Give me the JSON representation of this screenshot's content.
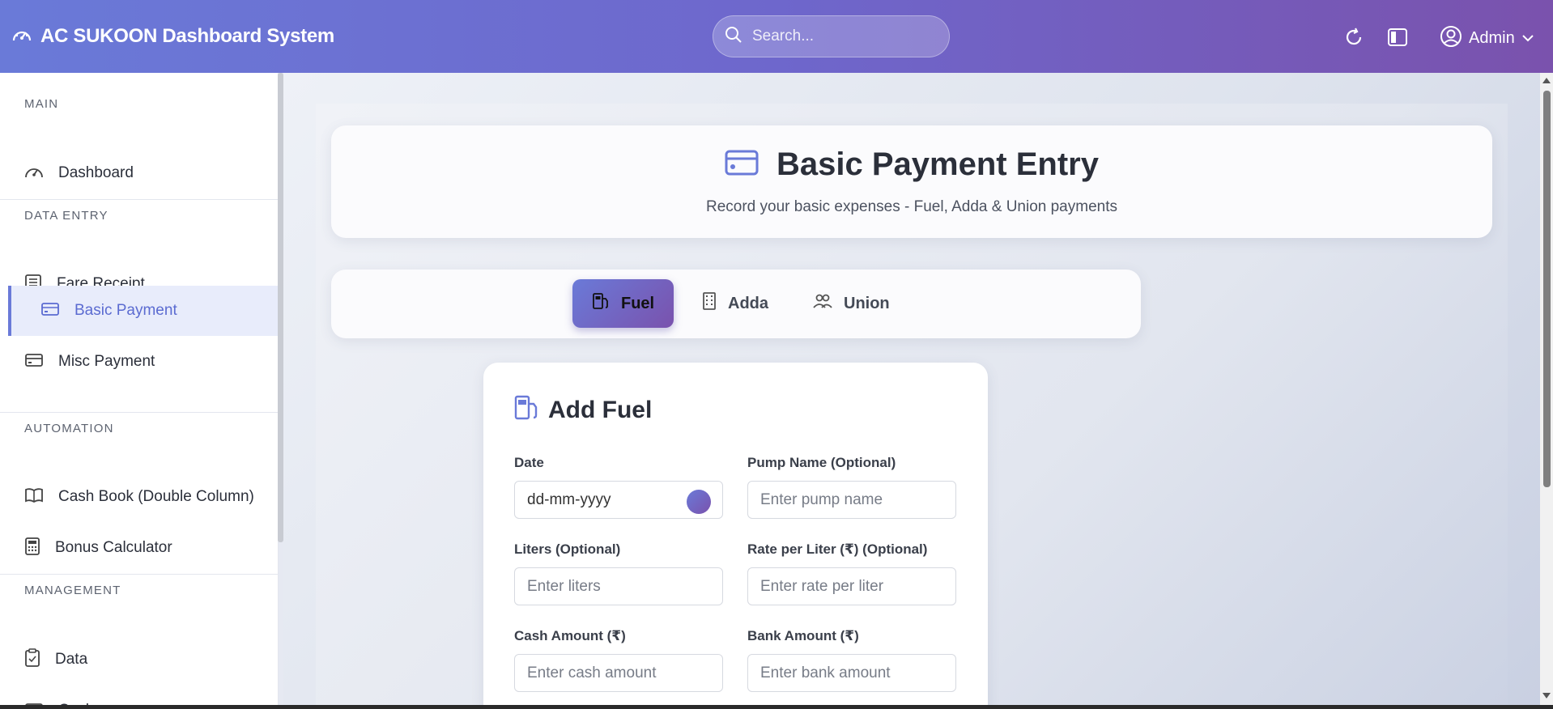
{
  "app": {
    "title": "AC SUKOON Dashboard System"
  },
  "search": {
    "placeholder": "Search..."
  },
  "header": {
    "admin_label": "Admin"
  },
  "sidebar": {
    "sections": [
      {
        "label": "MAIN",
        "items": [
          {
            "label": "Dashboard",
            "icon": "gauge-icon"
          }
        ]
      },
      {
        "label": "DATA ENTRY",
        "items": [
          {
            "label": "Fare Receipt",
            "icon": "receipt-icon"
          },
          {
            "label": "Basic Payment",
            "icon": "credit-card-icon",
            "active": true
          },
          {
            "label": "Misc Payment",
            "icon": "card-icon"
          }
        ]
      },
      {
        "label": "AUTOMATION",
        "items": [
          {
            "label": "Cash Book (Double Column)",
            "icon": "book-icon"
          },
          {
            "label": "Bonus Calculator",
            "icon": "calculator-icon"
          }
        ]
      },
      {
        "label": "MANAGEMENT",
        "items": [
          {
            "label": "Data",
            "icon": "clipboard-icon"
          },
          {
            "label": "Cash",
            "icon": "cash-icon"
          }
        ]
      }
    ]
  },
  "page": {
    "title": "Basic Payment Entry",
    "subtitle": "Record your basic expenses - Fuel, Adda & Union payments"
  },
  "tabs": [
    {
      "label": "Fuel",
      "icon": "fuel-pump-icon",
      "active": true
    },
    {
      "label": "Adda",
      "icon": "building-icon"
    },
    {
      "label": "Union",
      "icon": "people-icon"
    }
  ],
  "form": {
    "title": "Add Fuel",
    "date": {
      "label": "Date",
      "value": "dd-mm-yyyy"
    },
    "pump": {
      "label": "Pump Name (Optional)",
      "placeholder": "Enter pump name"
    },
    "liters": {
      "label": "Liters (Optional)",
      "placeholder": "Enter liters"
    },
    "rate": {
      "label": "Rate per Liter (₹) (Optional)",
      "placeholder": "Enter rate per liter"
    },
    "cash": {
      "label": "Cash Amount (₹)",
      "placeholder": "Enter cash amount"
    },
    "bank": {
      "label": "Bank Amount (₹)",
      "placeholder": "Enter bank amount"
    }
  },
  "colors": {
    "accent": "#6a7ad8",
    "accent_end": "#7a52ad",
    "active_bg": "#e8ecfb"
  }
}
